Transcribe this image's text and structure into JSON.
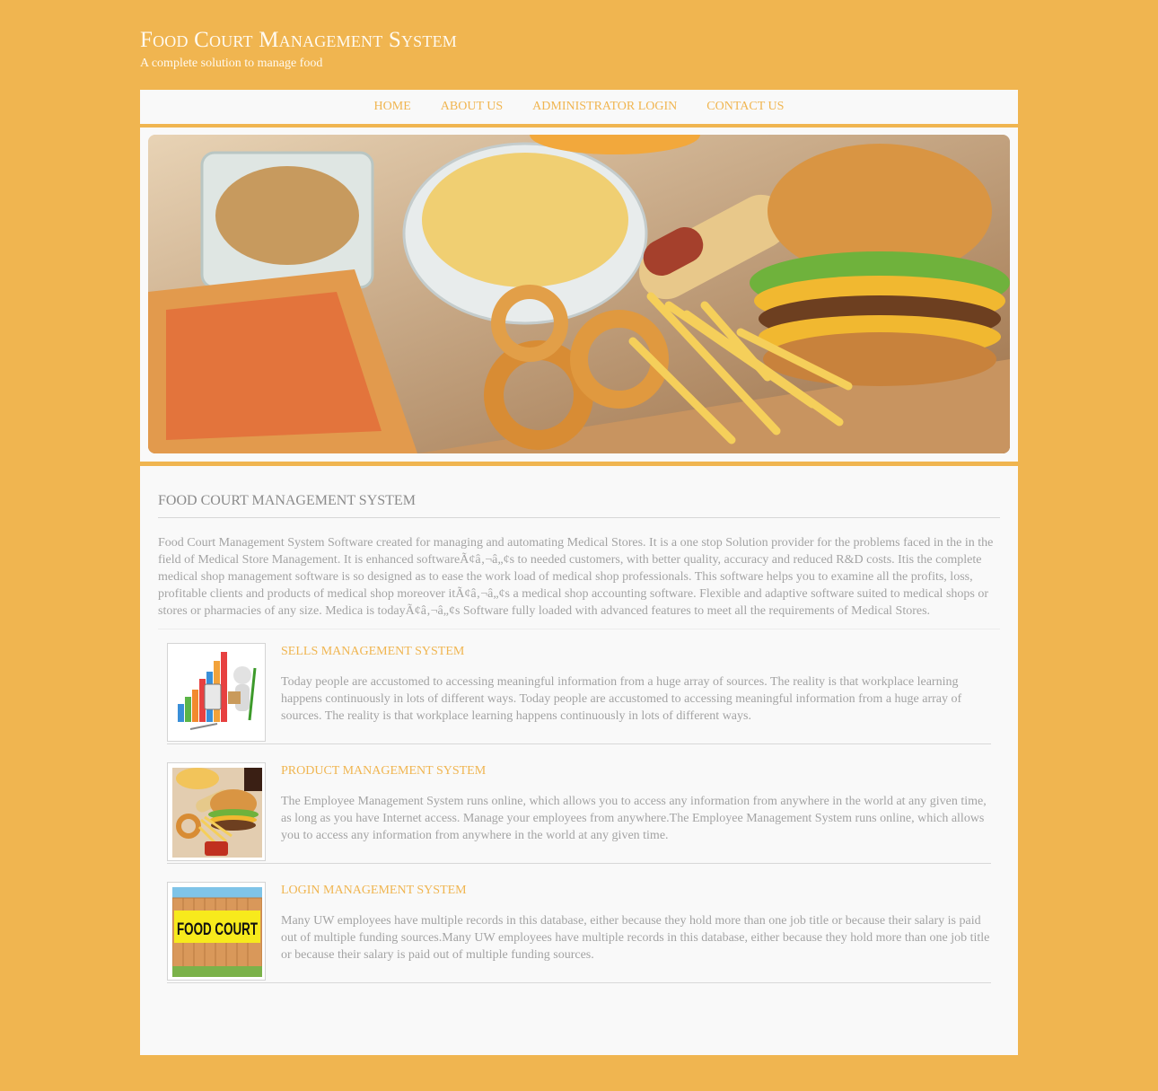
{
  "header": {
    "title": "Food Court Management System",
    "tagline": "A complete solution to manage food"
  },
  "nav": {
    "items": [
      {
        "label": "HOME"
      },
      {
        "label": "ABOUT US"
      },
      {
        "label": "ADMINISTRATOR LOGIN"
      },
      {
        "label": "CONTACT US"
      }
    ]
  },
  "banner": {
    "image": "fast-food-banner (pizza, nuts, chips, onion rings, fries, hot dog, burger)"
  },
  "main": {
    "heading": "FOOD COURT MANAGEMENT SYSTEM",
    "intro": "Food Court Management System Software created for managing and automating Medical Stores. It is a one stop Solution provider for the problems faced in the in the field of Medical Store Management. It is enhanced softwareÃ¢â‚¬â„¢s to needed customers, with better quality, accuracy and reduced R&D costs. Itis the complete medical shop management software is so designed as to ease the work load of medical shop professionals. This software helps you to examine all the profits, loss, profitable clients and products of medical shop moreover itÃ¢â‚¬â„¢s a medical shop accounting software. Flexible and adaptive software suited to medical shops or stores or pharmacies of any size. Medica is todayÃ¢â‚¬â„¢s Software fully loaded with advanced features to meet all the requirements of Medical Stores.",
    "features": [
      {
        "title": "SELLS MANAGEMENT SYSTEM",
        "image": "sales-chart-figure",
        "text": "Today people are accustomed to accessing meaningful information from a huge array of sources. The reality is that workplace learning happens continuously in lots of different ways. Today people are accustomed to accessing meaningful information from a huge array of sources. The reality is that workplace learning happens continuously in lots of different ways."
      },
      {
        "title": "PRODUCT MANAGEMENT SYSTEM",
        "image": "fast-food-plate",
        "text": "The Employee Management System runs online, which allows you to access any information from anywhere in the world at any given time, as long as you have Internet access. Manage your employees from anywhere.The Employee Management System runs online, which allows you to access any information from anywhere in the world at any given time."
      },
      {
        "title": "LOGIN MANAGEMENT SYSTEM",
        "image": "food-court-sign",
        "image_text": "FOOD COURT",
        "text": "Many UW employees have multiple records in this database, either because they hold more than one job title or because their salary is paid out of multiple funding sources.Many UW employees have multiple records in this database, either because they hold more than one job title or because their salary is paid out of multiple funding sources."
      }
    ]
  },
  "colors": {
    "brand": "#f0b550",
    "panel": "#f9f9f9",
    "heading_text": "#8b8b8b",
    "body_text": "#a3a3a3"
  }
}
